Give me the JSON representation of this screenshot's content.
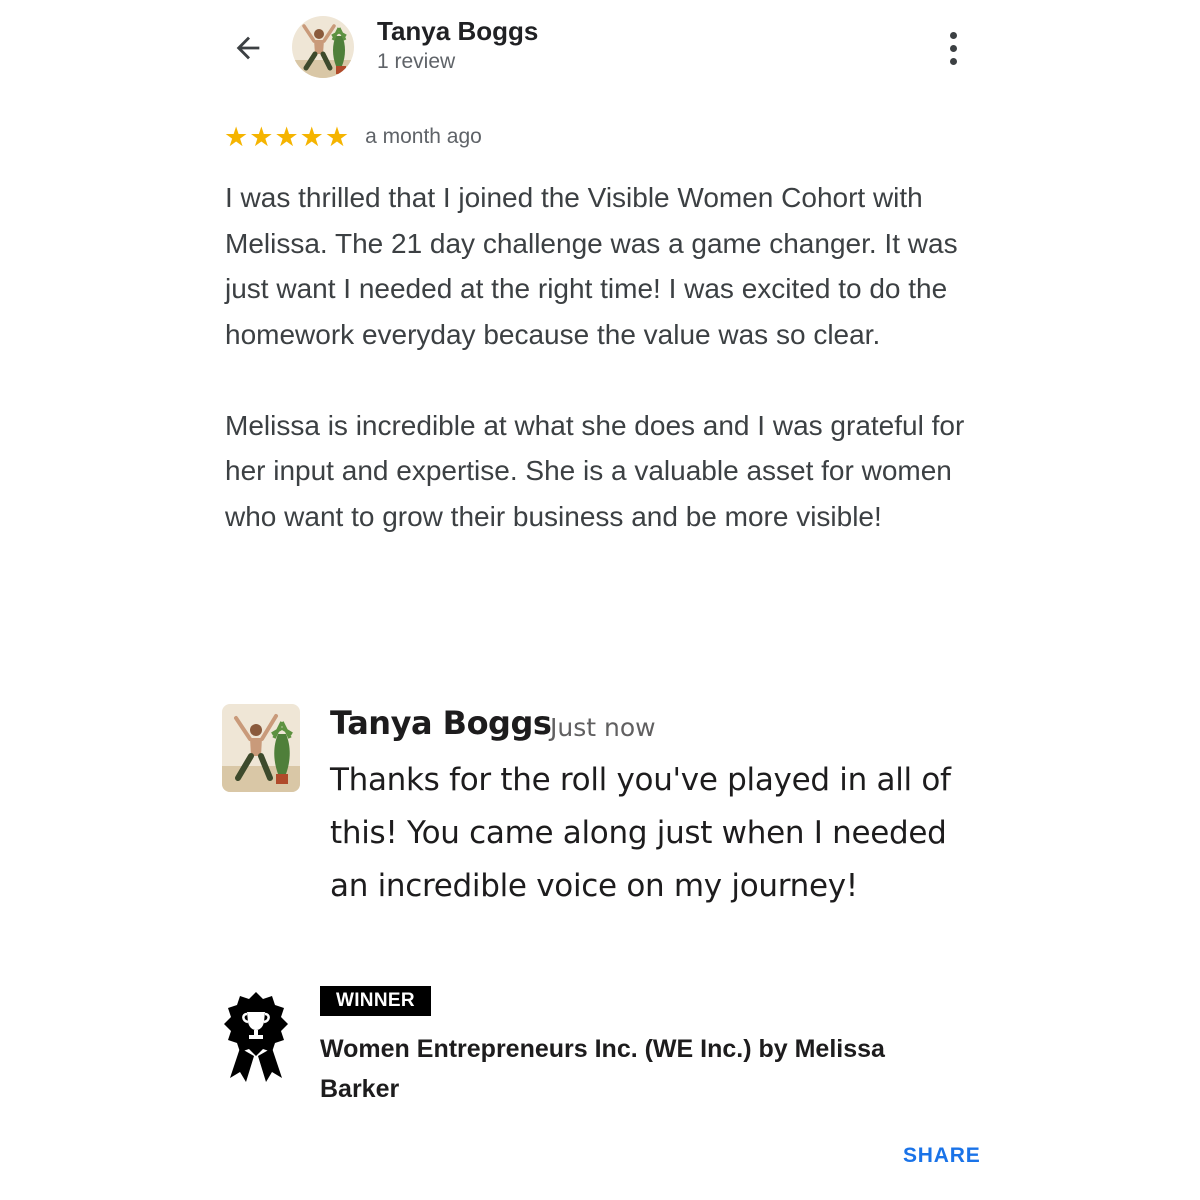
{
  "header": {
    "back_icon": "arrow-back-icon",
    "reviewer_name": "Tanya Boggs",
    "review_count": "1 review",
    "more_icon": "more-vertical-icon"
  },
  "review": {
    "rating": 5,
    "rating_max": 5,
    "star_color": "#f5b400",
    "time_ago": "a month ago",
    "paragraphs": [
      "I was thrilled that I joined the Visible Women Cohort with Melissa. The 21 day challenge was a game changer. It was just want I needed at the right time! I was excited to do the homework everyday because the value was so clear.",
      "Melissa is incredible at what she does and I was grateful for her input and expertise. She is a valuable asset for women who want to grow their business and be more visible!"
    ]
  },
  "reply": {
    "name": "Tanya Boggs",
    "time": "Just now",
    "text": "Thanks for the roll you've played in all of this! You came along just when I needed an incredible voice on my journey!"
  },
  "award": {
    "icon": "award-trophy-icon",
    "tag": "WINNER",
    "name": "Women Entrepreneurs Inc. (WE Inc.) by Melissa Barker"
  },
  "actions": {
    "share_label": "SHARE",
    "accent_color": "#1a73e8"
  }
}
